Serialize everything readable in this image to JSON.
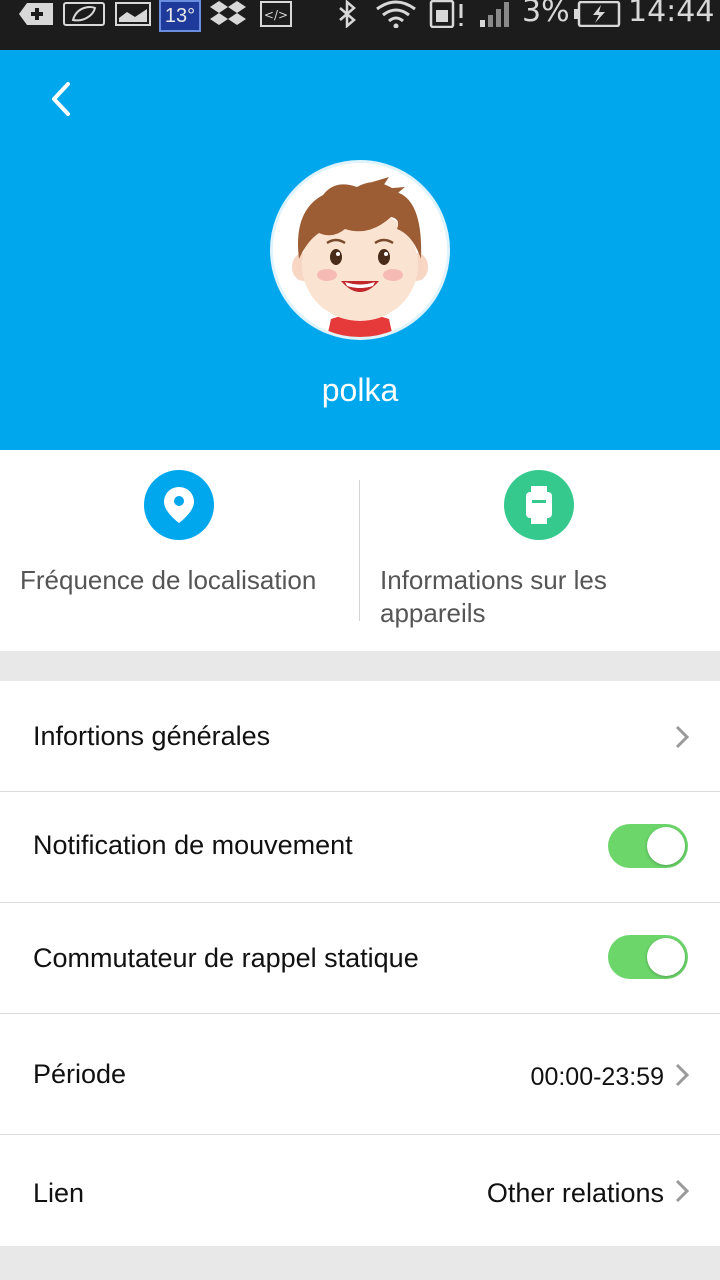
{
  "status_bar": {
    "temperature": "13°",
    "battery": "3%",
    "time": "14:44"
  },
  "header": {
    "name": "polka",
    "background": "#00a7ed"
  },
  "quick_actions": [
    {
      "label": "Fréquence de localisation",
      "icon": "location-pin-icon",
      "color": "#00a7ed"
    },
    {
      "label": "Informations sur les appareils",
      "icon": "watch-icon",
      "color": "#35c98e"
    }
  ],
  "settings": {
    "general": {
      "label": "Infortions générales"
    },
    "movement": {
      "label": "Notification de mouvement",
      "enabled": true
    },
    "static": {
      "label": "Commutateur de rappel statique",
      "enabled": true
    },
    "period": {
      "label": "Période",
      "value": "00:00-23:59"
    },
    "link": {
      "label": "Lien",
      "value": "Other relations"
    }
  },
  "colors": {
    "toggle_on": "#6cd66b"
  }
}
